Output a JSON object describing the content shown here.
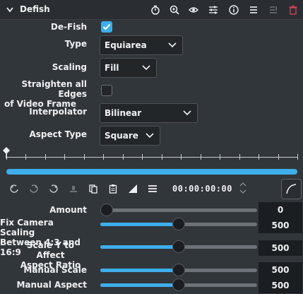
{
  "header": {
    "title": "Defish",
    "icons": [
      "timer-icon",
      "zoom-icon",
      "eye-icon",
      "sliders-icon",
      "info-icon",
      "menu-icon",
      "save-preset-icon",
      "trash-icon"
    ]
  },
  "params": {
    "defish": {
      "label": "De-Fish",
      "checked": true
    },
    "type": {
      "label": "Type",
      "value": "Equiarea"
    },
    "scaling": {
      "label": "Scaling",
      "value": "Fill"
    },
    "straighten": {
      "label_line1": "Straighten all Edges",
      "label_line2": "of Video Frame",
      "checked": false
    },
    "interpolator": {
      "label": "Interpolator",
      "value": "Bilinear"
    },
    "aspect_type": {
      "label": "Aspect Type",
      "value": "Square"
    }
  },
  "timeline": {
    "timecode": "00:00:00:00"
  },
  "sliders": [
    {
      "label": "Amount",
      "value": "0",
      "fraction": 0.0
    },
    {
      "label_line1": "Fix Camera Scaling",
      "label_line2": "Between 4:3 and 16:9",
      "value": "500",
      "fraction": 0.5
    },
    {
      "label_line1": "Scale Y to Affect",
      "label_line2": "Aspect Ratio",
      "value": "500",
      "fraction": 0.5
    },
    {
      "label": "Manual Scale",
      "value": "500",
      "fraction": 0.5
    },
    {
      "label": "Manual Aspect",
      "value": "500",
      "fraction": 0.5
    }
  ],
  "colors": {
    "accent": "#3daee9",
    "background": "#31363b",
    "trash": "#da4453"
  }
}
